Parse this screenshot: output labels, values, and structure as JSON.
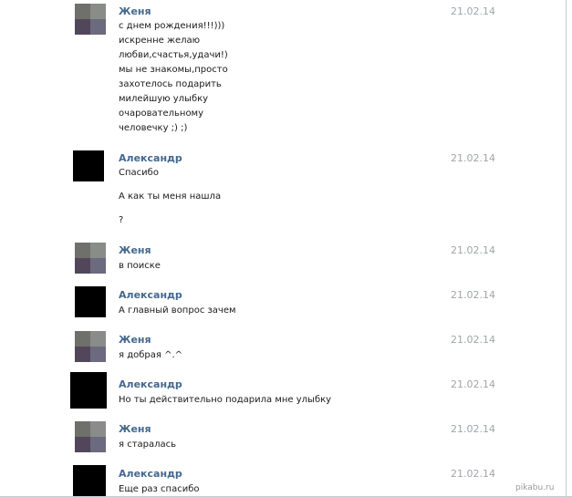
{
  "messages": [
    {
      "author": "Женя",
      "date": "21.02.14",
      "avatar": "pixelated-avatar",
      "lines": [
        "с днем рождения!!!)))",
        "искренне желаю",
        "любви,счастья,удачи!)",
        "мы не знакомы,просто",
        "захотелось подарить",
        "милейшую улыбку",
        "очаровательному",
        "человечку ;) ;)"
      ]
    },
    {
      "author": "Александр",
      "date": "21.02.14",
      "avatar": "black-avatar",
      "lines": [
        "Спасибо",
        "А как ты меня нашла",
        "?"
      ]
    },
    {
      "author": "Женя",
      "date": "21.02.14",
      "avatar": "pixelated-avatar",
      "lines": [
        "в поиске"
      ]
    },
    {
      "author": "Александр",
      "date": "21.02.14",
      "avatar": "black-avatar",
      "lines": [
        "А главный вопрос зачем"
      ]
    },
    {
      "author": "Женя",
      "date": "21.02.14",
      "avatar": "pixelated-avatar",
      "lines": [
        "я добрая ^.^"
      ]
    },
    {
      "author": "Александр",
      "date": "21.02.14",
      "avatar": "black-avatar",
      "lines": [
        "Но ты действительно подарила мне улыбку"
      ]
    },
    {
      "author": "Женя",
      "date": "21.02.14",
      "avatar": "pixelated-avatar",
      "lines": [
        "я старалась"
      ]
    },
    {
      "author": "Александр",
      "date": "21.02.14",
      "avatar": "black-avatar",
      "lines": [
        "Еще раз спасибо"
      ]
    }
  ],
  "watermark": "pikabu.ru",
  "colors": {
    "author": "#45688e",
    "date": "#a1a5a9",
    "text": "#1a1a1a"
  }
}
